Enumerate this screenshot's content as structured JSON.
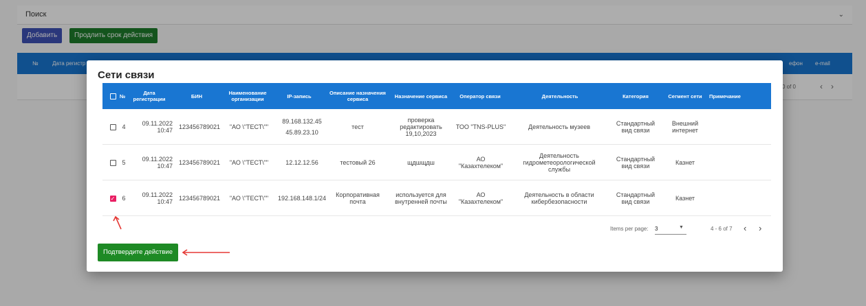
{
  "background": {
    "search_label": "Поиск",
    "add_button": "Добавить",
    "extend_button": "Продлить срок действия",
    "header_cols": [
      "№",
      "Дата регистр",
      "ефон",
      "e-mail"
    ],
    "pagination": "0 of 0"
  },
  "dialog": {
    "title": "Сети связи",
    "columns": [
      "№",
      "Дата регистрации",
      "БИН",
      "Наименование организации",
      "IP-запись",
      "Описание назначения сервиса",
      "Назначение сервиса",
      "Оператор связи",
      "Деятельность",
      "Категория",
      "Сегмент сети",
      "Примечание"
    ],
    "rows": [
      {
        "num": "4",
        "checked": false,
        "date": "09.11.2022",
        "time": "10:47",
        "bin": "123456789021",
        "org": "\"АО \\\"ТЕСТ\\\"\"",
        "ip1": "89.168.132.45",
        "ip2": "45.89.23.10",
        "desc": "тест",
        "purpose": "проверка редактировать 19,10,2023",
        "operator": "ТОО \"TNS-PLUS\"",
        "activity": "Деятельность музеев",
        "category": "Стандартный вид связи",
        "segment": "Внешний интернет",
        "note": ""
      },
      {
        "num": "5",
        "checked": false,
        "date": "09.11.2022",
        "time": "10:47",
        "bin": "123456789021",
        "org": "\"АО \\\"ТЕСТ\\\"\"",
        "ip1": "12.12.12.56",
        "ip2": "",
        "desc": "тестовый 26",
        "purpose": "щдшщдш",
        "operator": "АО \"Казахтелеком\"",
        "activity": "Деятельность гидрометеорологической службы",
        "category": "Стандартный вид связи",
        "segment": "Казнет",
        "note": ""
      },
      {
        "num": "6",
        "checked": true,
        "date": "09.11.2022",
        "time": "10:47",
        "bin": "123456789021",
        "org": "\"АО \\\"ТЕСТ\\\"\"",
        "ip1": "192.168.148.1/24",
        "ip2": "",
        "desc": "Корпоративная почта",
        "purpose": "используется для внутренней почты",
        "operator": "АО \"Казахтелеком\"",
        "activity": "Деятельность в области кибербезопасности",
        "category": "Стандартный вид связи",
        "segment": "Казнет",
        "note": ""
      }
    ],
    "paginator": {
      "items_per_page_label": "Items per page:",
      "items_per_page_value": "3",
      "range": "4 - 6 of 7"
    },
    "confirm_button": "Подтвердите действие"
  },
  "colors": {
    "header_blue": "#1976d2",
    "confirm_green": "#1e8a25",
    "checkbox_pink": "#e91e63",
    "annotation_red": "#e53935"
  }
}
